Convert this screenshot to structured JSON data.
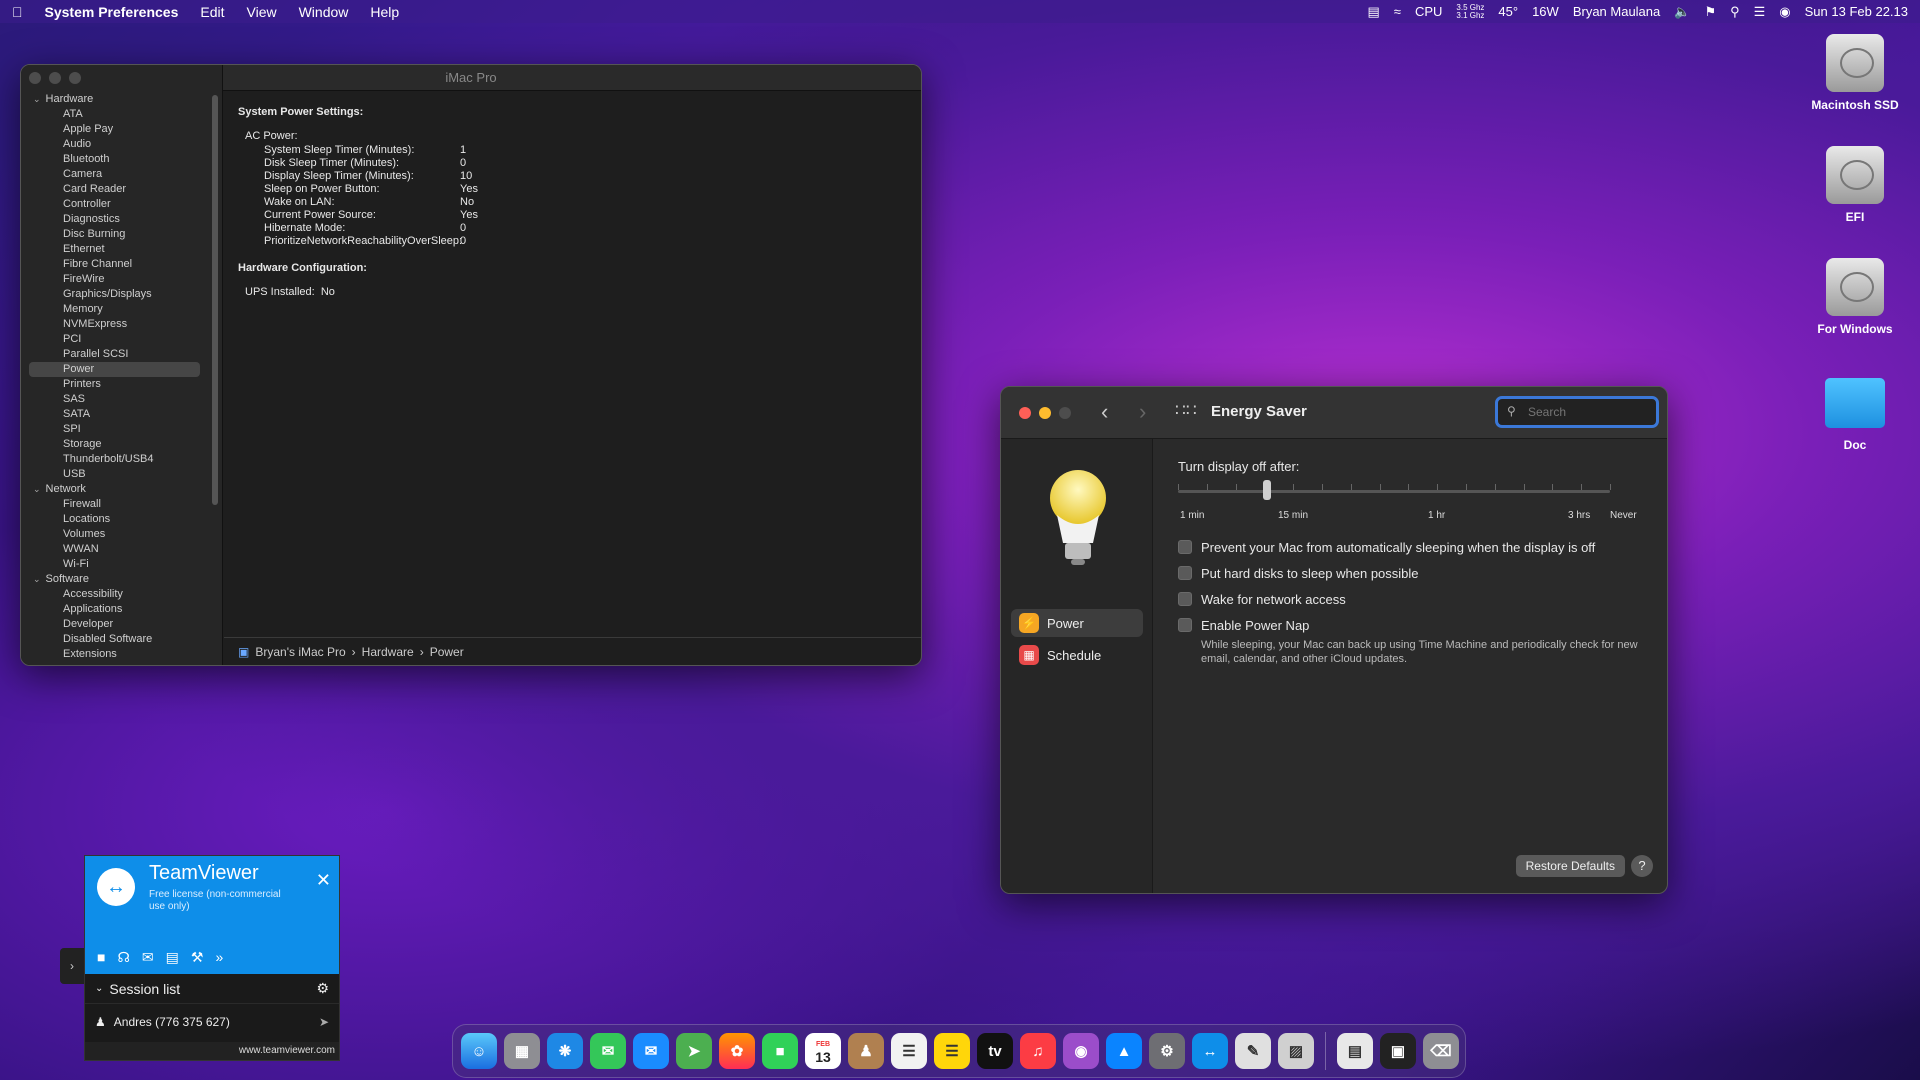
{
  "menubar": {
    "app": "System Preferences",
    "menus": [
      "Edit",
      "View",
      "Window",
      "Help"
    ],
    "cpu_label": "CPU",
    "cpu_freq_top": "3.5 Ghz",
    "cpu_freq_bottom": "3.1 Ghz",
    "temp": "45°",
    "power": "16W",
    "user": "Bryan Maulana",
    "datetime": "Sun 13 Feb  22.13"
  },
  "sysinfo": {
    "title": "iMac Pro",
    "groups": [
      {
        "name": "Hardware",
        "items": [
          "ATA",
          "Apple Pay",
          "Audio",
          "Bluetooth",
          "Camera",
          "Card Reader",
          "Controller",
          "Diagnostics",
          "Disc Burning",
          "Ethernet",
          "Fibre Channel",
          "FireWire",
          "Graphics/Displays",
          "Memory",
          "NVMExpress",
          "PCI",
          "Parallel SCSI",
          "Power",
          "Printers",
          "SAS",
          "SATA",
          "SPI",
          "Storage",
          "Thunderbolt/USB4",
          "USB"
        ]
      },
      {
        "name": "Network",
        "items": [
          "Firewall",
          "Locations",
          "Volumes",
          "WWAN",
          "Wi-Fi"
        ]
      },
      {
        "name": "Software",
        "items": [
          "Accessibility",
          "Applications",
          "Developer",
          "Disabled Software",
          "Extensions"
        ]
      }
    ],
    "selected": "Power",
    "heading1": "System Power Settings:",
    "ac_label": "AC Power:",
    "settings": [
      {
        "k": "System Sleep Timer (Minutes):",
        "v": "1"
      },
      {
        "k": "Disk Sleep Timer (Minutes):",
        "v": "0"
      },
      {
        "k": "Display Sleep Timer (Minutes):",
        "v": "10"
      },
      {
        "k": "Sleep on Power Button:",
        "v": "Yes"
      },
      {
        "k": "Wake on LAN:",
        "v": "No"
      },
      {
        "k": "Current Power Source:",
        "v": "Yes"
      },
      {
        "k": "Hibernate Mode:",
        "v": "0"
      },
      {
        "k": "PrioritizeNetworkReachabilityOverSleep:",
        "v": "0"
      }
    ],
    "heading2": "Hardware Configuration:",
    "ups_label": "UPS Installed:",
    "ups_value": "No",
    "breadcrumb": [
      "Bryan's iMac Pro",
      "Hardware",
      "Power"
    ]
  },
  "energy": {
    "title": "Energy Saver",
    "search_placeholder": "Search",
    "nav": [
      {
        "label": "Power",
        "color": "#f5a623"
      },
      {
        "label": "Schedule",
        "color": "#e84a4a"
      }
    ],
    "slider_label": "Turn display off after:",
    "slider_value_fraction": 0.205,
    "slider_ticks": [
      "1 min",
      "15 min",
      "1 hr",
      "3 hrs",
      "Never"
    ],
    "options": [
      "Prevent your Mac from automatically sleeping when the display is off",
      "Put hard disks to sleep when possible",
      "Wake for network access",
      "Enable Power Nap"
    ],
    "power_nap_desc": "While sleeping, your Mac can back up using Time Machine and periodically check for new email, calendar, and other iCloud updates.",
    "restore_label": "Restore Defaults",
    "help": "?"
  },
  "desktop": [
    "Macintosh SSD",
    "EFI",
    "For Windows",
    "Doc"
  ],
  "teamviewer": {
    "name": "TeamViewer",
    "license": "Free license (non-commercial use only)",
    "session_list": "Session list",
    "user": "Andres (776 375 627)",
    "url": "www.teamviewer.com"
  },
  "dock": {
    "calendar_month": "FEB",
    "calendar_day": "13",
    "tv_label": "tv"
  }
}
